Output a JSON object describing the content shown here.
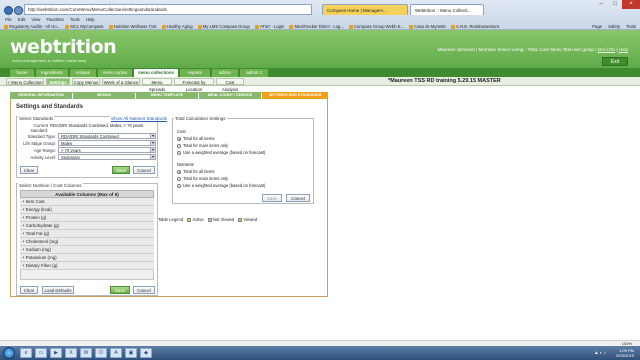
{
  "browser": {
    "address": "http://webtrition.com/CoreMenu/MenuCollection/settingsandstandards",
    "tabs": [
      {
        "label": "Compass Home | Managem..."
      },
      {
        "label": "Webtrition :: Menu Collecti..."
      }
    ],
    "menu": [
      "File",
      "Edit",
      "View",
      "Favorites",
      "Tools",
      "Help"
    ],
    "favorites": [
      "Regulatory Audits - All Go...",
      "MCL MyCompass",
      "Nutrition Wellness TSS",
      "Healthy Aging",
      "My LMS Compass Group",
      "AT&T - Login",
      "MealTracker Direct - Log...",
      "Compass Group Webb E...",
      "Casa de Mynette",
      "A.N.D. Reimbursement"
    ],
    "tools": [
      "Page",
      "Safety",
      "Tools"
    ]
  },
  "app": {
    "logo": "webtrition",
    "tagline": "menu management & nutrition made easy",
    "user_line": "Maureen Jameson | Morrison Senior Living - *MSL Core Menu Test user group |",
    "user_links": [
      "Mail (29)",
      "Help"
    ],
    "exit_label": "Exit"
  },
  "modules": [
    "home",
    "ingredients",
    "recipes",
    "menu cycles",
    "menu collections",
    "reports",
    "admin",
    "admin 2"
  ],
  "active_module": "menu collections",
  "subnav": [
    "< Menu Collection",
    "Settings",
    "Copy Menus",
    "Week of a Glance",
    "Menu Spreads",
    "Forecast by Location",
    "Cost Analysis"
  ],
  "active_subnav": "Settings",
  "training_title": "*Maureen TSS RD training 5.29.15 MASTER",
  "steps": [
    "GENERAL INFORMATION",
    "MENUS",
    "MENU TEMPLATE",
    "MEAL COUNT / CENSUS",
    "SETTINGS AND STANDARDS"
  ],
  "active_step": "SETTINGS AND STANDARDS",
  "settings": {
    "title": "Settings and Standards",
    "select_standards": {
      "legend": "Select Standards",
      "show_all_link": "Show All Nutrient Standards",
      "current_label": "Current standard:",
      "current_value": "RDA/DRI Standards Combined, Males, > 70 years",
      "fields": [
        {
          "label": "Standard Type:",
          "value": "RDA/DRI Standards Combined"
        },
        {
          "label": "Life Stage Group:",
          "value": "Males"
        },
        {
          "label": "Age Range:",
          "value": "> 70 years"
        },
        {
          "label": "Activity Level:",
          "value": "Sedentary"
        }
      ],
      "buttons": {
        "clear": "Clear",
        "save": "Save",
        "cancel": "Cancel"
      }
    },
    "nutrient_columns": {
      "legend": "Select Nutrition / Cost Columns",
      "header": "Available Columns (Max of 9)",
      "items": [
        "Item Cost",
        "Energy (kcal)",
        "Protein (g)",
        "Carbohydrate (g)",
        "Total Fat (g)",
        "Cholesterol (mg)",
        "Sodium (mg)",
        "Potassium (mg)",
        "Dietary Fiber (g)"
      ],
      "buttons": {
        "clear": "Clear",
        "load_defaults": "Load Defaults",
        "save": "Save",
        "cancel": "Cancel"
      }
    },
    "total_calc": {
      "legend": "Total Calculation Settings",
      "cost_label": "Cost",
      "cost_options": [
        "Total for all items",
        "Total for main items only",
        "Use a weighted average (based on forecast)"
      ],
      "cost_selected": 0,
      "nutrients_label": "Nutrients",
      "nutrient_options": [
        "Total for all items",
        "Total for main items only",
        "Use a weighted average (based on forecast)"
      ],
      "nutrient_selected": 0,
      "buttons": {
        "save": "Save",
        "cancel": "Cancel"
      }
    },
    "legend": {
      "title": "Table Legend",
      "items": [
        {
          "label": "Active",
          "color": "#f2c94c"
        },
        {
          "label": "Not Viewed",
          "color": "#d0d0d0"
        },
        {
          "label": "Viewed",
          "color": "#a4cf73"
        }
      ]
    }
  },
  "status": {
    "zoom": "100%"
  },
  "taskbar": {
    "time": "1:09 PM",
    "date": "5/29/2015"
  }
}
